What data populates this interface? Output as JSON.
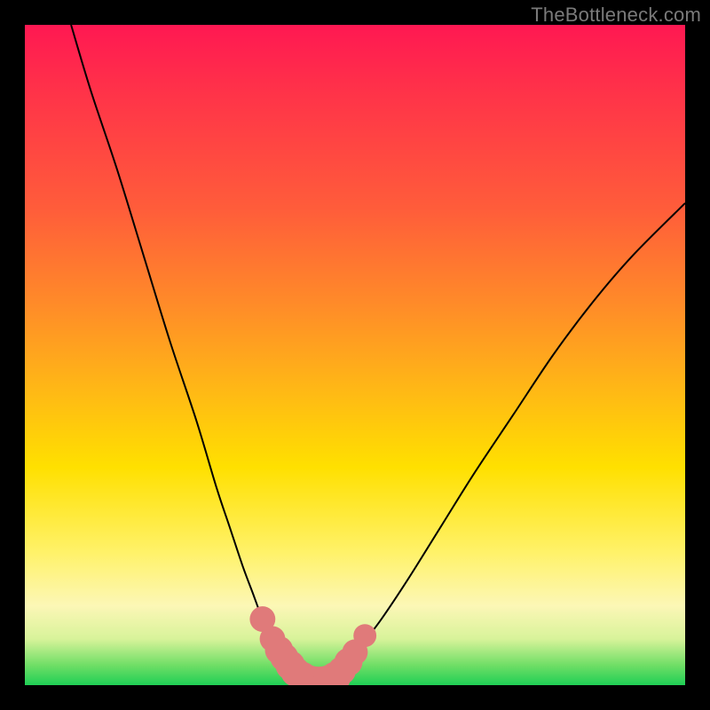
{
  "watermark": "TheBottleneck.com",
  "chart_data": {
    "type": "line",
    "title": "",
    "xlabel": "",
    "ylabel": "",
    "xlim": [
      0,
      100
    ],
    "ylim": [
      0,
      100
    ],
    "grid": false,
    "background_gradient_stops": [
      {
        "pos": 0,
        "color": "#ff1852"
      },
      {
        "pos": 10,
        "color": "#ff3249"
      },
      {
        "pos": 28,
        "color": "#ff5d3a"
      },
      {
        "pos": 42,
        "color": "#ff8a29"
      },
      {
        "pos": 55,
        "color": "#ffb716"
      },
      {
        "pos": 67,
        "color": "#ffe000"
      },
      {
        "pos": 80,
        "color": "#fff26a"
      },
      {
        "pos": 88,
        "color": "#fcf7b6"
      },
      {
        "pos": 93,
        "color": "#d8f39a"
      },
      {
        "pos": 97,
        "color": "#6fde66"
      },
      {
        "pos": 100,
        "color": "#1fcf55"
      }
    ],
    "series": [
      {
        "name": "left-branch",
        "x": [
          7,
          10,
          14,
          18,
          22,
          26,
          29,
          31,
          33,
          34.5,
          36,
          37.5,
          39,
          40.5,
          42
        ],
        "y": [
          100,
          90,
          78,
          65,
          52,
          40,
          30,
          24,
          18,
          14,
          10,
          7,
          4.5,
          2.5,
          1
        ]
      },
      {
        "name": "right-branch",
        "x": [
          47,
          49,
          51,
          54,
          58,
          63,
          68,
          74,
          80,
          86,
          92,
          100
        ],
        "y": [
          1,
          3,
          6,
          10,
          16,
          24,
          32,
          41,
          50,
          58,
          65,
          73
        ]
      },
      {
        "name": "bottom-link",
        "x": [
          42,
          43.5,
          45,
          46,
          47
        ],
        "y": [
          1,
          0.5,
          0.5,
          0.7,
          1
        ]
      }
    ],
    "marker_points": {
      "comment": "pink/salmon markers near the trough",
      "points": [
        {
          "x": 36.0,
          "y": 10.0,
          "r": 1.4
        },
        {
          "x": 37.5,
          "y": 7.0,
          "r": 1.4
        },
        {
          "x": 38.5,
          "y": 5.3,
          "r": 1.6
        },
        {
          "x": 39.3,
          "y": 4.2,
          "r": 1.6
        },
        {
          "x": 40.2,
          "y": 3.0,
          "r": 1.7
        },
        {
          "x": 41.0,
          "y": 2.0,
          "r": 1.7
        },
        {
          "x": 42.0,
          "y": 1.2,
          "r": 1.8
        },
        {
          "x": 43.0,
          "y": 0.7,
          "r": 1.8
        },
        {
          "x": 44.0,
          "y": 0.5,
          "r": 1.8
        },
        {
          "x": 45.0,
          "y": 0.5,
          "r": 1.8
        },
        {
          "x": 46.0,
          "y": 0.7,
          "r": 1.8
        },
        {
          "x": 47.0,
          "y": 1.2,
          "r": 1.8
        },
        {
          "x": 48.0,
          "y": 2.2,
          "r": 1.6
        },
        {
          "x": 49.0,
          "y": 3.5,
          "r": 1.6
        },
        {
          "x": 50.0,
          "y": 5.0,
          "r": 1.4
        },
        {
          "x": 51.5,
          "y": 7.5,
          "r": 1.2
        }
      ]
    }
  }
}
